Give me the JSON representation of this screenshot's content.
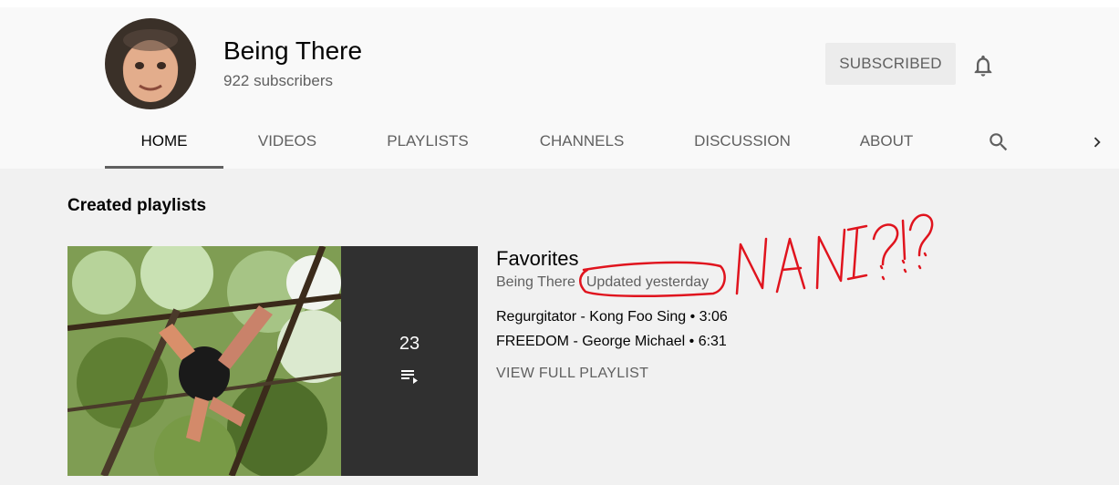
{
  "channel": {
    "title": "Being There",
    "subscribers": "922 subscribers",
    "subscribe_label": "SUBSCRIBED"
  },
  "tabs": [
    {
      "label": "HOME",
      "active": true
    },
    {
      "label": "VIDEOS",
      "active": false
    },
    {
      "label": "PLAYLISTS",
      "active": false
    },
    {
      "label": "CHANNELS",
      "active": false
    },
    {
      "label": "DISCUSSION",
      "active": false
    },
    {
      "label": "ABOUT",
      "active": false
    }
  ],
  "icons": {
    "bell": "bell-icon",
    "search": "search-icon",
    "next": "chevron-right-icon",
    "playlist": "playlist-icon"
  },
  "section": {
    "title": "Created playlists"
  },
  "playlist": {
    "title": "Favorites",
    "owner": "Being There",
    "updated": "Updated yesterday",
    "video_count": "23",
    "videos": [
      {
        "title": "Regurgitator - Kong Foo Sing",
        "sep": "•",
        "duration": "3:06"
      },
      {
        "title": "FREEDOM - George Michael",
        "sep": "•",
        "duration": "6:31"
      }
    ],
    "view_full_label": "VIEW FULL PLAYLIST"
  },
  "annotation": {
    "text": "NANI?!?...",
    "color": "#e0141e"
  },
  "colors": {
    "header_bg": "#f9f9f9",
    "page_bg": "#f1f1f1",
    "text_primary": "#030303",
    "text_secondary": "#606060",
    "button_bg": "#ececec"
  }
}
